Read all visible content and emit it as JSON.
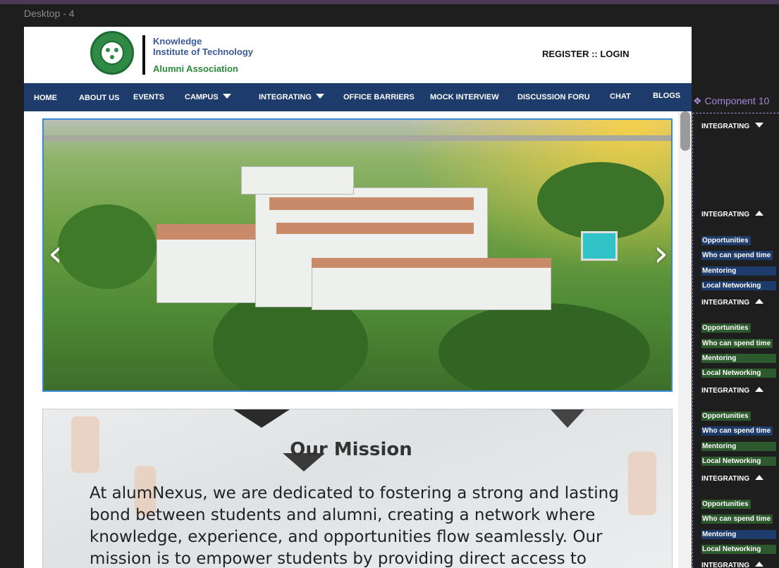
{
  "frame_label": "Desktop - 4",
  "header": {
    "brand_line1": "Knowledge",
    "brand_line2": "Institute of Technology",
    "brand_line3": "Alumni Association",
    "register_login": "REGISTER :: LOGIN"
  },
  "nav": {
    "items": [
      "HOME",
      "ABOUT US",
      "EVENTS",
      "CAMPUS",
      "INTEGRATING",
      "OFFICE BARRIERS",
      "MOCK INTERVIEW",
      "DISCUSSION FORU",
      "CHAT",
      "BLOGS"
    ]
  },
  "hero": {
    "prev": "‹",
    "next": "›"
  },
  "mission": {
    "title": "Our Mission",
    "text": "At alumNexus, we are dedicated to fostering a strong and lasting bond between students and alumni, creating a network where knowledge, experience, and opportunities flow seamlessly. Our mission is to empower students by providing direct access to"
  },
  "component": {
    "label": "❖ Component 10",
    "menu_label": "INTEGRATING",
    "submenu": [
      "Opportunities",
      "Who can spend time",
      "Mentoring",
      "Local Networking"
    ]
  },
  "colors": {
    "nav_bg": "#1d3b6b",
    "brand_blue": "#3a5a9a",
    "brand_green": "#2a8a3c",
    "component_accent": "#a08ad8"
  }
}
